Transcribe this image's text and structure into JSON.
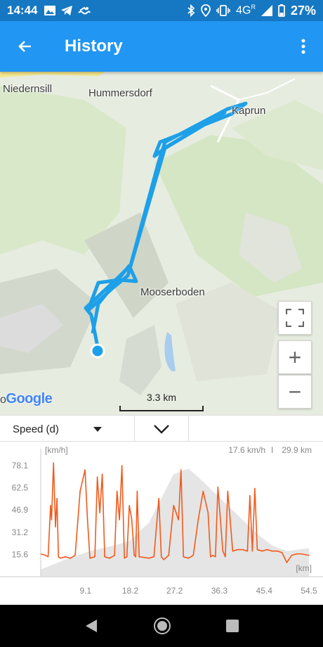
{
  "status_bar": {
    "time": "14:44",
    "left_icons": [
      "image-icon",
      "telegram-icon",
      "swim-icon"
    ],
    "right_icons": [
      "bluetooth-icon",
      "location-icon",
      "vibrate-icon"
    ],
    "network": "4G",
    "network_sup": "R",
    "battery": "27%"
  },
  "app_bar": {
    "title": "History",
    "back_icon": "arrow-left-icon",
    "menu_icon": "more-vert-icon"
  },
  "map": {
    "places": {
      "niedernsill": "Niedernsill",
      "hummersdorf": "Hummersdorf",
      "kaprun": "Kaprun",
      "mooserboden": "Mooserboden"
    },
    "attribution": "Google",
    "attribution_prefix": "o",
    "scale_label": "3.3 km",
    "buttons": {
      "fullscreen": "fullscreen-icon",
      "zoom_in": "+",
      "zoom_out": "−"
    },
    "track_color": "#1ea0e8"
  },
  "selector": {
    "field_label": "Speed (d)",
    "expand_icon": "chevron-down-icon"
  },
  "chart_data": {
    "type": "area",
    "ylabel": "[km/h]",
    "xlabel": "[km]",
    "y_ticks": [
      "78.1",
      "62.5",
      "46.9",
      "31.2",
      "15.6"
    ],
    "x_ticks": [
      "9.1",
      "18.2",
      "27.2",
      "36.3",
      "45.4",
      "54.5"
    ],
    "stats": [
      "17.6 km/h",
      "29.9 km"
    ],
    "xlim": [
      0,
      54.5
    ],
    "ylim": [
      0,
      85
    ],
    "series": [
      {
        "color": "#f25a1d",
        "x": [
          0,
          1,
          1.5,
          2,
          2.2,
          2.6,
          3,
          3.3,
          3.6,
          4,
          5,
          6,
          7,
          8,
          9,
          9.5,
          10,
          11,
          11.5,
          12,
          12.5,
          13,
          14,
          15,
          15.5,
          16,
          16.5,
          17,
          17.5,
          18,
          18.5,
          19,
          19.3,
          19.6,
          20,
          22,
          23,
          24,
          24.5,
          25,
          26,
          27,
          28,
          28.5,
          29,
          30,
          31,
          32,
          33,
          34,
          34.5,
          35,
          35.5,
          36,
          37,
          37.5,
          38,
          38.5,
          39,
          40,
          41,
          42,
          42.5,
          43,
          43.5,
          44,
          45,
          46,
          47,
          48,
          49,
          50,
          51,
          52,
          53,
          54.5
        ],
        "values": [
          16,
          15,
          14,
          50,
          40,
          80,
          35,
          55,
          14,
          13,
          14,
          13,
          15,
          60,
          75,
          40,
          13,
          14,
          70,
          45,
          72,
          14,
          13,
          15,
          60,
          40,
          78,
          13,
          14,
          50,
          40,
          15,
          14,
          60,
          14,
          13,
          14,
          55,
          14,
          12,
          15,
          50,
          40,
          75,
          14,
          13,
          15,
          40,
          60,
          45,
          14,
          15,
          14,
          63,
          18,
          14,
          60,
          40,
          18,
          19,
          19,
          18,
          57,
          18,
          62,
          19,
          18,
          19,
          18,
          18,
          17,
          10,
          15,
          16,
          16,
          15
        ]
      },
      {
        "color": "#e2e2e2",
        "x": [
          0,
          5,
          10,
          15,
          18,
          22,
          27,
          30,
          32,
          35,
          38,
          41,
          44,
          47,
          50,
          54.5
        ],
        "values": [
          5,
          12,
          18,
          22,
          25,
          38,
          72,
          76,
          70,
          60,
          50,
          40,
          30,
          22,
          18,
          20
        ]
      }
    ]
  },
  "nav_bar": {
    "back": "triangle-back-icon",
    "home": "circle-home-icon",
    "recents": "square-recents-icon"
  }
}
